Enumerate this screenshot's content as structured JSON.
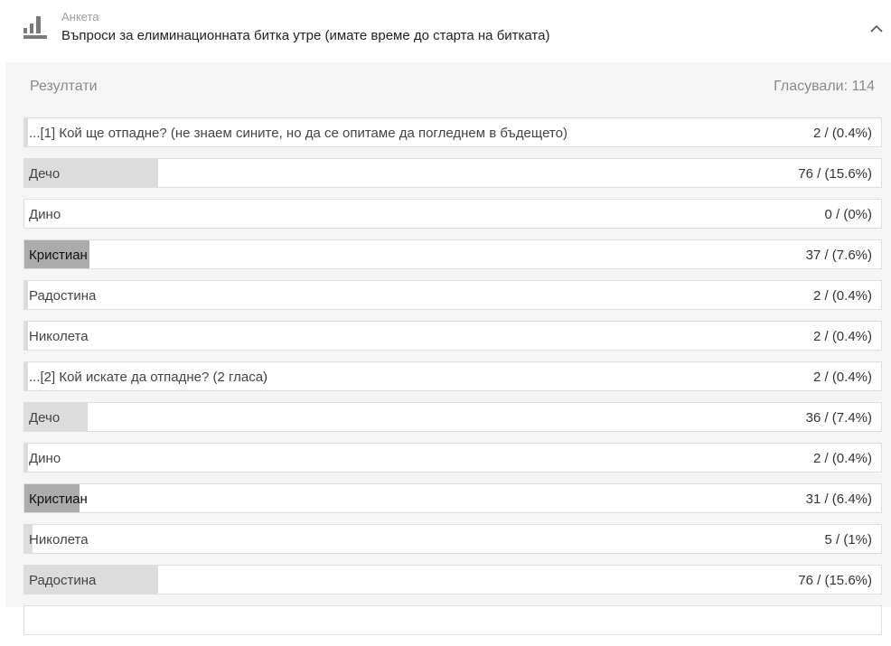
{
  "poll": {
    "kind": "Анкета",
    "title": "Въпроси за елиминационната битка утре (имате време до старта на битката)",
    "icon": "bar-chart-icon",
    "collapse_icon": "chevron-up-icon"
  },
  "results": {
    "label": "Резултати",
    "total_votes": "Гласували: 114"
  },
  "options": [
    {
      "label": "...[1] Кой ще отпадне? (не знаем сините, но да се опитаме да погледнем в бъдещето)",
      "count": "2 / (0.4%)",
      "fill": 0.004,
      "shade": "light"
    },
    {
      "label": "Дечо",
      "count": "76 / (15.6%)",
      "fill": 0.156,
      "shade": "light"
    },
    {
      "label": "Дино",
      "count": "0 / (0%)",
      "fill": 0,
      "shade": "light"
    },
    {
      "label": "Кристиан",
      "count": "37 / (7.6%)",
      "fill": 0.076,
      "shade": "dark"
    },
    {
      "label": "Радостина",
      "count": "2 / (0.4%)",
      "fill": 0.004,
      "shade": "light"
    },
    {
      "label": "Николета",
      "count": "2 / (0.4%)",
      "fill": 0.004,
      "shade": "light"
    },
    {
      "label": "...[2] Кой искате да отпадне? (2 гласа)",
      "count": "2 / (0.4%)",
      "fill": 0.004,
      "shade": "light"
    },
    {
      "label": "Дечо",
      "count": "36 / (7.4%)",
      "fill": 0.074,
      "shade": "light"
    },
    {
      "label": "Дино",
      "count": "2 / (0.4%)",
      "fill": 0.004,
      "shade": "light"
    },
    {
      "label": "Кристиан",
      "count": "31 / (6.4%)",
      "fill": 0.064,
      "shade": "dark"
    },
    {
      "label": "Николета",
      "count": "5 / (1%)",
      "fill": 0.01,
      "shade": "light"
    },
    {
      "label": "Радостина",
      "count": "76 / (15.6%)",
      "fill": 0.156,
      "shade": "light"
    },
    {
      "label": "",
      "count": "",
      "fill": 0,
      "shade": "light"
    }
  ],
  "colors": {
    "bar_light": "#dcdcdc",
    "bar_dark": "#acacac",
    "panel_bg": "#f5f5f5"
  }
}
